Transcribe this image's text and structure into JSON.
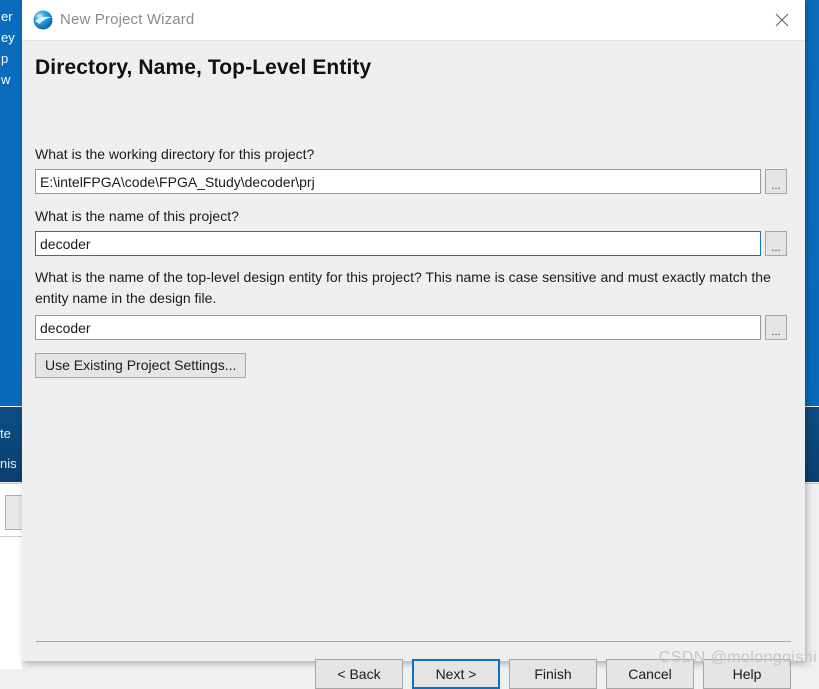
{
  "window": {
    "title": "New Project Wizard",
    "icon": "quartus-sphere-icon",
    "close_label": "✕",
    "accent_color": "#0a72c4"
  },
  "page": {
    "title": "Directory, Name, Top-Level Entity"
  },
  "fields": [
    {
      "question": "What is the working directory for this project?",
      "value": "E:\\intelFPGA\\code\\FPGA_Study\\decoder\\prj",
      "browse_label": "...",
      "focused": false
    },
    {
      "question": "What is the name of this project?",
      "value": "decoder",
      "browse_label": "...",
      "focused": true
    },
    {
      "question": "What is the name of the top-level design entity for this project? This name is case sensitive and must exactly match the entity name in the design file.",
      "value": "decoder",
      "browse_label": "...",
      "focused": false
    }
  ],
  "use_existing": {
    "label": "Use Existing Project Settings..."
  },
  "buttons": [
    {
      "label": "< Back",
      "default": false
    },
    {
      "label": "Next >",
      "default": true
    },
    {
      "label": "Finish",
      "default": false
    },
    {
      "label": "Cancel",
      "default": false
    },
    {
      "label": "Help",
      "default": false
    }
  ],
  "watermark": {
    "text": "CSDN @molongqishi"
  },
  "background": {
    "left_strip_lines": [
      "er",
      "ey",
      "p",
      "w"
    ],
    "left_navy_lines": [
      "te",
      "nis"
    ],
    "blue_color": "#0b6cbd",
    "navy_color": "#0c4d84"
  }
}
